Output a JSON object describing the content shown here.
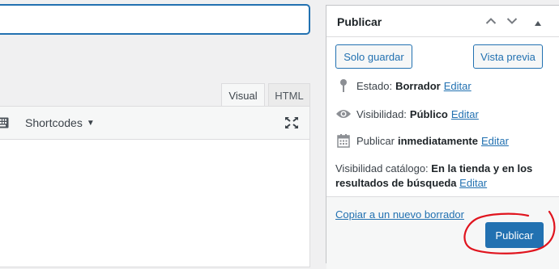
{
  "editor": {
    "tabs": [
      {
        "label": "Visual"
      },
      {
        "label": "HTML"
      }
    ],
    "toolbar": {
      "shortcodes_label": "Shortcodes",
      "keyboard_icon": "keyboard-icon",
      "fullscreen_icon": "fullscreen-icon"
    }
  },
  "publish_box": {
    "title": "Publicar",
    "header_icons": [
      "chevron-up-icon",
      "chevron-down-icon",
      "toggle-arrow-icon"
    ],
    "save_draft_label": "Solo guardar",
    "preview_label": "Vista previa",
    "status": {
      "label": "Estado:",
      "value": "Borrador",
      "edit": "Editar",
      "icon": "pin-icon"
    },
    "visibility": {
      "label": "Visibilidad:",
      "value": "Público",
      "edit": "Editar",
      "icon": "eye-icon"
    },
    "schedule": {
      "label": "Publicar",
      "value": "inmediatamente",
      "edit": "Editar",
      "icon": "calendar-icon"
    },
    "catalog_visibility": {
      "label": "Visibilidad catálogo:",
      "value": "En la tienda y en los resultados de búsqueda",
      "edit": "Editar"
    },
    "copy_draft_label": "Copiar a un nuevo borrador",
    "publish_label": "Publicar"
  },
  "colors": {
    "accent": "#2271b1",
    "annotation": "#e0141e",
    "background": "#f0f0f1"
  }
}
